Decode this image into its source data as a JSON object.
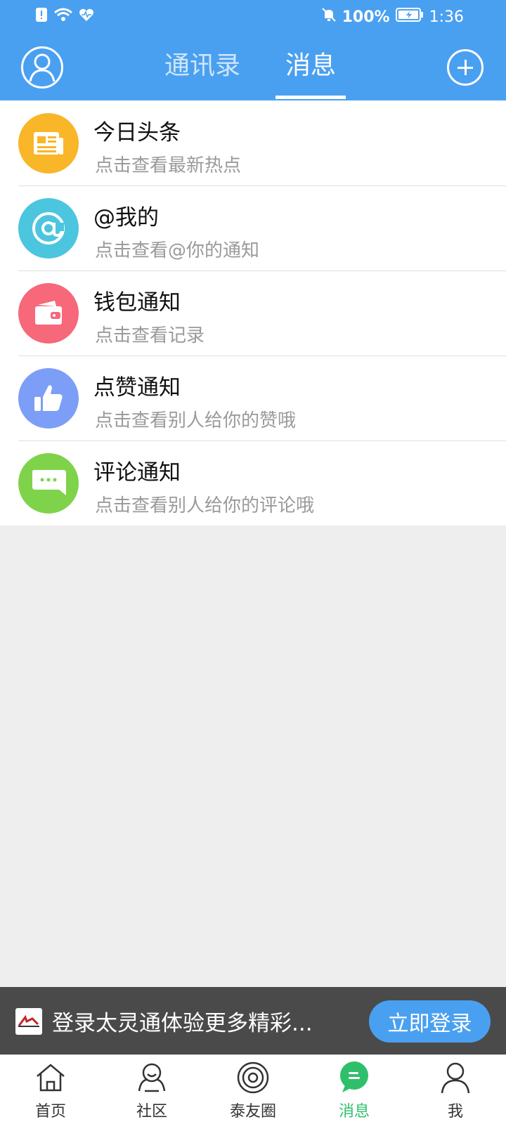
{
  "status_bar": {
    "battery_percent": "100%",
    "time": "1:36",
    "icons": [
      "notification-icon",
      "wifi-icon",
      "heart-rate-icon",
      "mute-icon",
      "battery-charging-icon"
    ]
  },
  "header": {
    "tabs": [
      {
        "label": "通讯录",
        "active": false
      },
      {
        "label": "消息",
        "active": true
      }
    ]
  },
  "messages": {
    "items": [
      {
        "title": "今日头条",
        "subtitle": "点击查看最新热点",
        "icon": "newspaper-icon",
        "color": "#f8b628"
      },
      {
        "title": "@我的",
        "subtitle": "点击查看@你的通知",
        "icon": "at-icon",
        "color": "#4cc6de"
      },
      {
        "title": "钱包通知",
        "subtitle": "点击查看记录",
        "icon": "wallet-icon",
        "color": "#f6687a"
      },
      {
        "title": "点赞通知",
        "subtitle": "点击查看别人给你的赞哦",
        "icon": "thumbs-up-icon",
        "color": "#7c9ef7"
      },
      {
        "title": "评论通知",
        "subtitle": "点击查看别人给你的评论哦",
        "icon": "comment-icon",
        "color": "#7fd34a"
      }
    ]
  },
  "banner": {
    "text": "登录太灵通体验更多精彩...",
    "button_label": "立即登录"
  },
  "bottom_nav": {
    "items": [
      {
        "label": "首页",
        "icon": "home-icon",
        "active": false
      },
      {
        "label": "社区",
        "icon": "community-icon",
        "active": false
      },
      {
        "label": "泰友圈",
        "icon": "circle-icon",
        "active": false
      },
      {
        "label": "消息",
        "icon": "message-icon",
        "active": true
      },
      {
        "label": "我",
        "icon": "person-icon",
        "active": false
      }
    ]
  },
  "colors": {
    "primary": "#4aa0f0",
    "active_nav": "#2fbf6a",
    "background": "#eeeeee"
  }
}
